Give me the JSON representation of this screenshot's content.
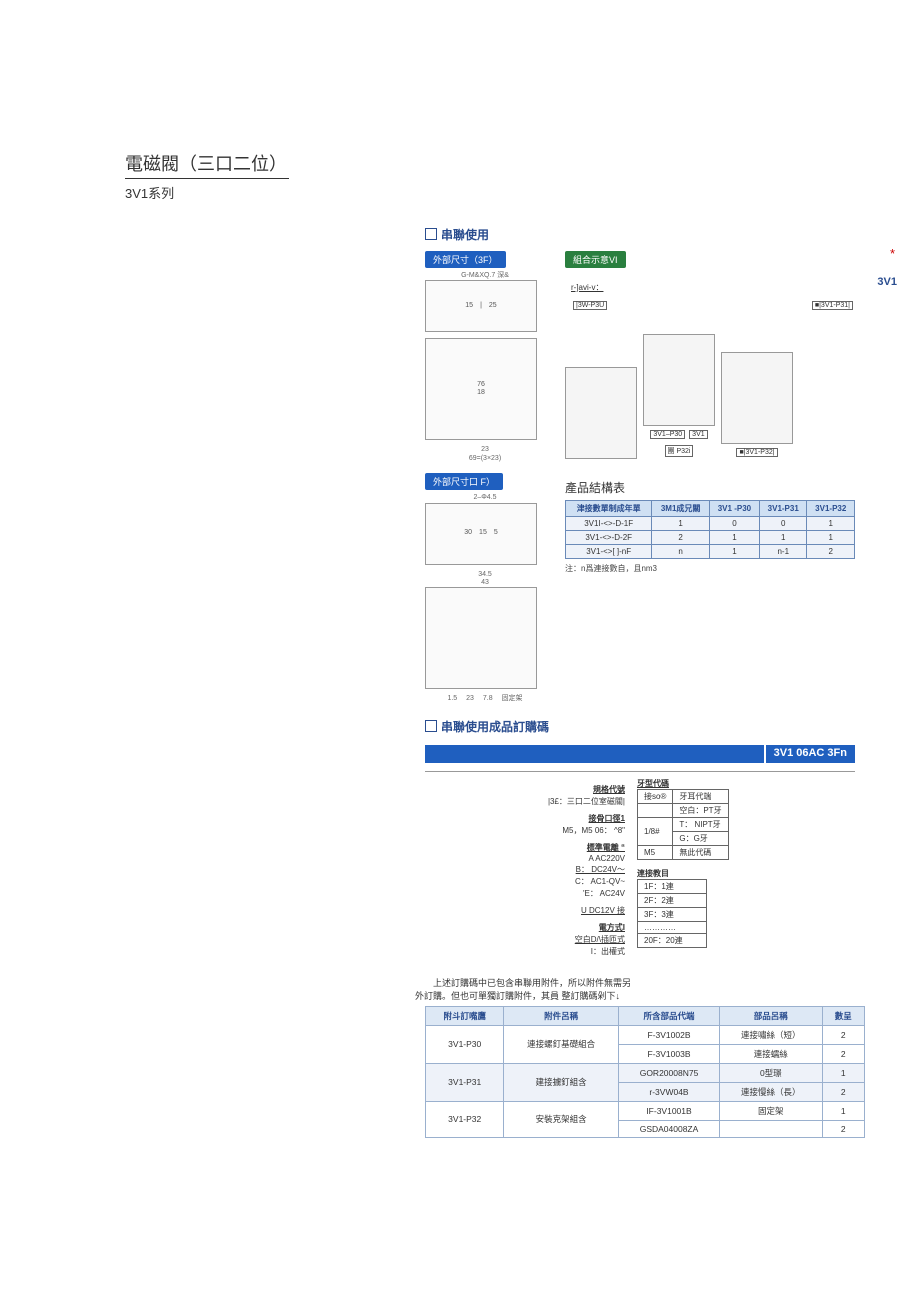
{
  "header": {
    "title": "電磁閥（三口二位）",
    "series": "3V1系列"
  },
  "side": {
    "star": "*",
    "label": "3V1"
  },
  "sections": {
    "serial_use": "串聯使用",
    "serial_order": "串聯使用成品訂購碼",
    "outer_3f": "外部尺寸（3F）",
    "assembly_vi": "組合示意VI",
    "outer_f": "外部尺寸口 F）",
    "struct_title": "產品結構表"
  },
  "diagram_labels": {
    "top_note": "G-M&XQ.7 深&",
    "dim_15": "15",
    "dim_25": "25",
    "dim_76": "76",
    "dim_18": "18",
    "dim_23": "23",
    "dim_69": "69=(3×23)",
    "phi": "2–Φ4.5",
    "dim_30": "30",
    "dim_15b": "15",
    "dim_5": "5",
    "dim_34_5": "34.5",
    "dim_43": "43",
    "dim_15c": "1.5",
    "dim_23b": "23",
    "dim_7_8": "7.8",
    "fixed": "固定架",
    "r_avi": "r-]avi-v：",
    "w_p3u": "|3W-P3U",
    "p31": "■|3V1-P31|",
    "p32": "■|3V1-P32|",
    "p30": "3V1–P30",
    "v3": "3V1",
    "tuan_p32": "團 P32i"
  },
  "struct_table": {
    "head": [
      "津接數單制成年單",
      "3M1成兄關",
      "3V1 -P30",
      "3V1-P31",
      "3V1-P32"
    ],
    "rows": [
      [
        "3V1I-<>-D-1F",
        "1",
        "0",
        "0",
        "1"
      ],
      [
        "3V1-<>-D-2F",
        "2",
        "1",
        "1",
        "1"
      ],
      [
        "3V1-<>[ ]-nF",
        "n",
        "1",
        "n-1",
        "2"
      ]
    ],
    "note": "注：n爲連接數自，且nm3"
  },
  "order_code": "3V1 06AC 3Fn",
  "code_spec": {
    "spec_h": "規格代號",
    "spec_line": "|3£：三口二位室磁關|",
    "port_h": "接骨口徑1",
    "port_line": "M5，M5 06： ^8\"",
    "volt_h": "標準電離 “",
    "volt_a": "A AC220V",
    "volt_b": "B： DC24V～",
    "volt_c": "C： AC1-QV~",
    "volt_e": "'E： AC24V",
    "volt_u": "U DC12V  接",
    "elec_h": "電方式I",
    "elec_blank": "空白D/\\插匝式",
    "elec_i": "I：出權式"
  },
  "thread_table": {
    "title": "牙型代碼",
    "rows": [
      [
        "接so®",
        "牙耳代端"
      ],
      [
        "",
        "空白：PT牙"
      ],
      [
        "1/8#",
        "T： NIPT牙"
      ],
      [
        "",
        "G：G牙"
      ],
      [
        "M5",
        "無此代碼"
      ]
    ]
  },
  "conn_table": {
    "title": "連接教目",
    "rows": [
      [
        "1F：1連"
      ],
      [
        "2F：2連"
      ],
      [
        "3F：3連"
      ],
      [
        "…………"
      ],
      [
        "20F：20連"
      ]
    ]
  },
  "acc_note": "　　上述訂購碼中已包含串聯用附件，所以附件無需另\n外訂購。但也可單獨訂購附件，其員 整訂購碼剁下↓",
  "acc_table": {
    "head": [
      "附斗訂嘴鷹",
      "附件呂稱",
      "所含部品代端",
      "部品呂稱",
      "數呈"
    ],
    "rows": [
      {
        "codes": [
          "3V1-P30",
          "連接螺釘基礎組合"
        ],
        "parts": [
          [
            "F-3V1002B",
            "連接嘯絲（短）",
            "2"
          ],
          [
            "F-3V1003B",
            "連接蠕絲",
            "2"
          ]
        ],
        "shade": false
      },
      {
        "codes": [
          "3V1-P31",
          "建接擄釘組含"
        ],
        "parts": [
          [
            "GOR20008N75",
            "0型璟",
            "1"
          ],
          [
            "r-3VW04B",
            "連接慢絲（長）",
            "2"
          ]
        ],
        "shade": true
      },
      {
        "codes": [
          "3V1-P32",
          "安裝克架組含"
        ],
        "parts": [
          [
            "IF-3V1001B",
            "固定架",
            "1"
          ],
          [
            "GSDA04008ZA",
            "",
            "2"
          ]
        ],
        "shade": false
      }
    ]
  }
}
